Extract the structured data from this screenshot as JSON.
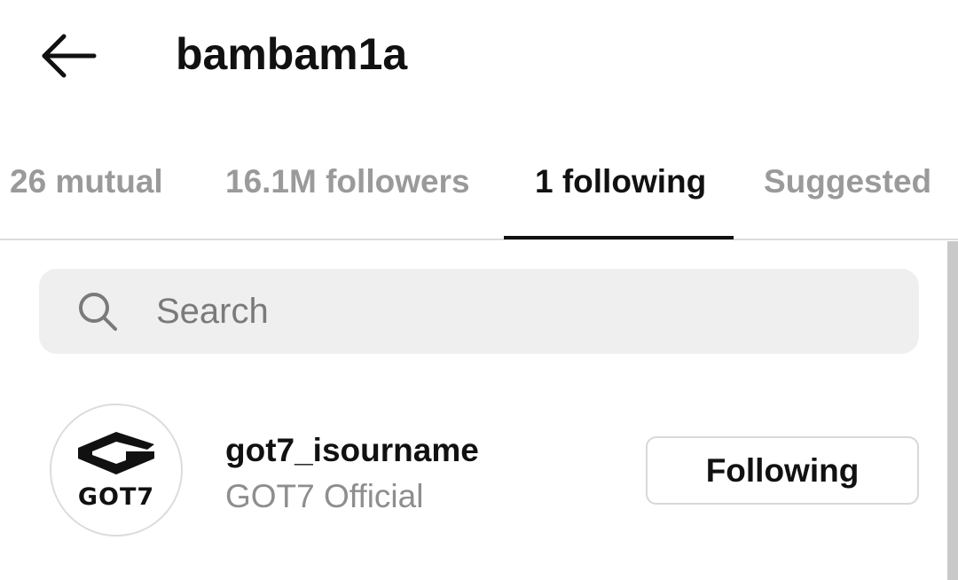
{
  "header": {
    "title": "bambam1a",
    "back_icon": "arrow-left-icon"
  },
  "tabs": [
    {
      "label": "26 mutual",
      "active": false
    },
    {
      "label": "16.1M followers",
      "active": false
    },
    {
      "label": "1 following",
      "active": true
    },
    {
      "label": "Suggested",
      "active": false
    }
  ],
  "search": {
    "placeholder": "Search",
    "value": "",
    "icon": "search-icon"
  },
  "accounts": [
    {
      "username": "got7_isourname",
      "full_name": "GOT7 Official",
      "button_label": "Following",
      "avatar_logo_text": "GOT7"
    }
  ],
  "colors": {
    "text_primary": "#111111",
    "text_secondary": "#8e8e8e",
    "tab_inactive": "#9a9a9a",
    "search_bg": "#efefef",
    "border": "#d8d8d8"
  }
}
